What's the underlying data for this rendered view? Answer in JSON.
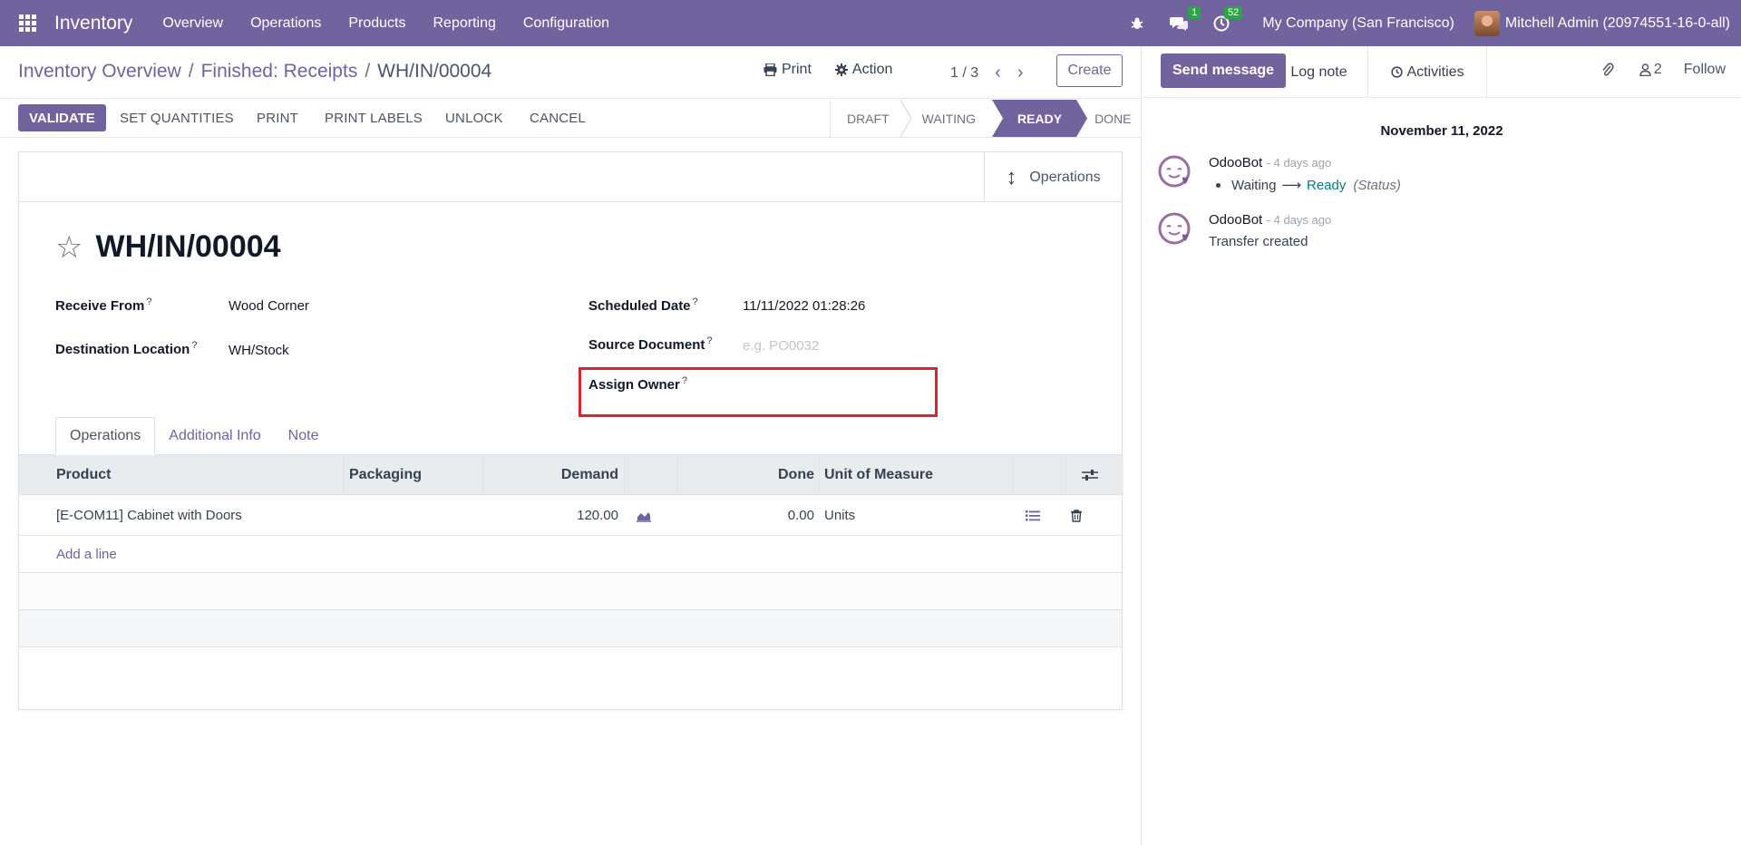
{
  "navbar": {
    "app_name": "Inventory",
    "menu": [
      "Overview",
      "Operations",
      "Products",
      "Reporting",
      "Configuration"
    ],
    "messages_count": "1",
    "activities_count": "52",
    "company": "My Company (San Francisco)",
    "user": "Mitchell Admin (20974551-16-0-all)"
  },
  "breadcrumb": {
    "items": [
      "Inventory Overview",
      "Finished: Receipts"
    ],
    "current": "WH/IN/00004"
  },
  "control": {
    "print_label": "Print",
    "action_label": "Action",
    "pager": "1 / 3",
    "create_label": "Create"
  },
  "buttons": {
    "validate": "VALIDATE",
    "set_quantities": "SET QUANTITIES",
    "print": "PRINT",
    "print_labels": "PRINT LABELS",
    "unlock": "UNLOCK",
    "cancel": "CANCEL"
  },
  "stages": [
    "DRAFT",
    "WAITING",
    "READY",
    "DONE"
  ],
  "active_stage": "READY",
  "smart_button": {
    "label": "Operations"
  },
  "record": {
    "name": "WH/IN/00004",
    "fields": {
      "receive_from": {
        "label": "Receive From",
        "value": "Wood Corner"
      },
      "destination": {
        "label": "Destination Location",
        "value": "WH/Stock"
      },
      "scheduled_date": {
        "label": "Scheduled Date",
        "value": "11/11/2022 01:28:26"
      },
      "source_document": {
        "label": "Source Document",
        "placeholder": "e.g. PO0032"
      },
      "assign_owner": {
        "label": "Assign Owner",
        "value": ""
      }
    },
    "help_mark": "?"
  },
  "tabs": [
    "Operations",
    "Additional Info",
    "Note"
  ],
  "table": {
    "headers": {
      "product": "Product",
      "packaging": "Packaging",
      "demand": "Demand",
      "done": "Done",
      "uom": "Unit of Measure"
    },
    "rows": [
      {
        "product": "[E-COM11] Cabinet with Doors",
        "packaging": "",
        "demand": "120.00",
        "done": "0.00",
        "uom": "Units"
      }
    ],
    "add_line": "Add a line"
  },
  "chatter": {
    "send_message": "Send message",
    "log_note": "Log note",
    "activities": "Activities",
    "followers_count": "2",
    "follow": "Follow",
    "date": "November 11, 2022",
    "messages": [
      {
        "author": "OdooBot",
        "when": "- 4 days ago",
        "old": "Waiting",
        "new": "Ready",
        "field": "(Status)"
      },
      {
        "author": "OdooBot",
        "when": "- 4 days ago",
        "text": "Transfer created"
      }
    ]
  },
  "colors": {
    "brand": "#71639e",
    "highlight": "#d9232d",
    "badge": "#28a745",
    "link_teal": "#017e84"
  }
}
